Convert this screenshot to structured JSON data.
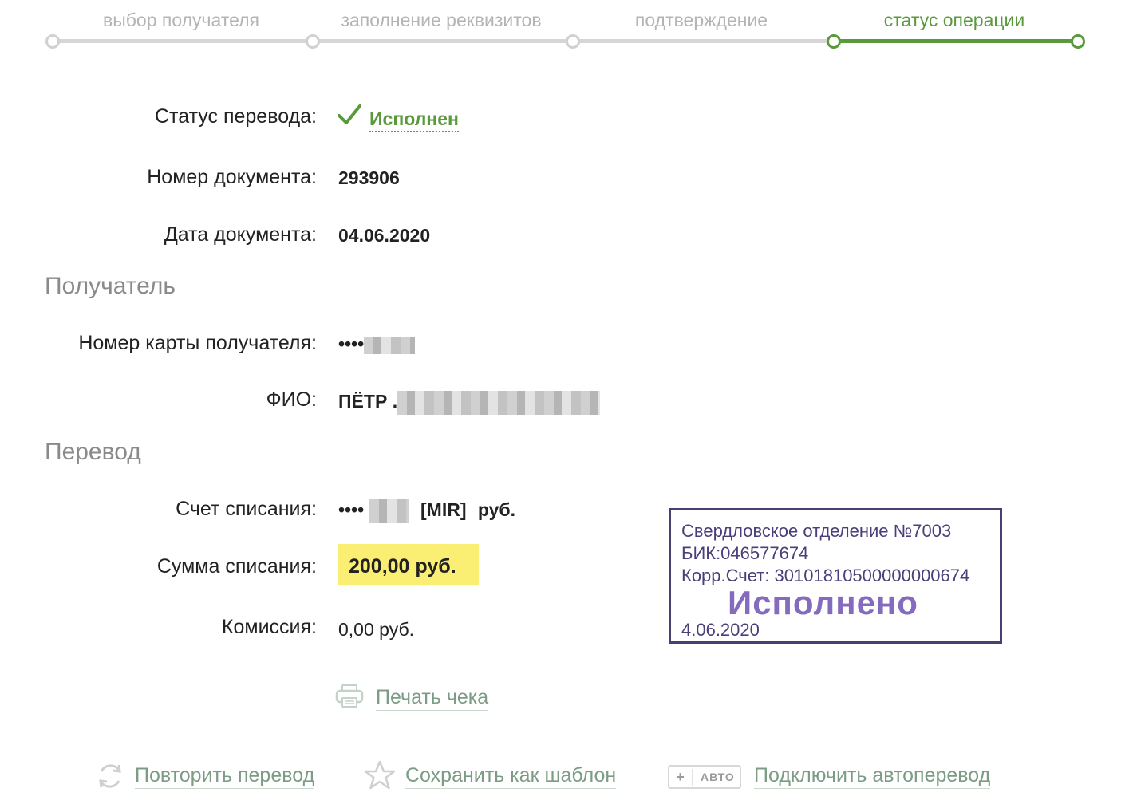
{
  "steps": [
    {
      "label": "выбор получателя"
    },
    {
      "label": "заполнение реквизитов"
    },
    {
      "label": "подтверждение"
    },
    {
      "label": "статус операции"
    }
  ],
  "status": {
    "label": "Статус перевода:",
    "value": "Исполнен"
  },
  "document_number": {
    "label": "Номер документа:",
    "value": "293906"
  },
  "document_date": {
    "label": "Дата документа:",
    "value": "04.06.2020"
  },
  "recipient_section": "Получатель",
  "recipient_card": {
    "label": "Номер карты получателя:",
    "value": "••••"
  },
  "recipient_name": {
    "label": "ФИО:",
    "value": "ПЁТР ."
  },
  "transfer_section": "Перевод",
  "debit_account": {
    "label": "Счет списания:",
    "value_prefix": "••••",
    "system": "[MIR]",
    "currency": "руб."
  },
  "debit_amount": {
    "label": "Сумма списания:",
    "value": "200,00  руб."
  },
  "commission": {
    "label": "Комиссия:",
    "value": "0,00 руб."
  },
  "stamp": {
    "line1": "Свердловское отделение №7003",
    "line2": "БИК:046577674",
    "line3": "Корр.Счет: 30101810500000000674",
    "big": "Исполнено",
    "date": "4.06.2020"
  },
  "actions": {
    "print": "Печать чека",
    "repeat": "Повторить перевод",
    "save_template": "Сохранить как шаблон",
    "auto_badge": "АВТО",
    "auto_plus": "+",
    "autotransfer": "Подключить автоперевод"
  },
  "colors": {
    "accent_green": "#5a9a3c",
    "highlight_yellow": "#fbef73",
    "stamp_purple": "#4a3f73"
  }
}
